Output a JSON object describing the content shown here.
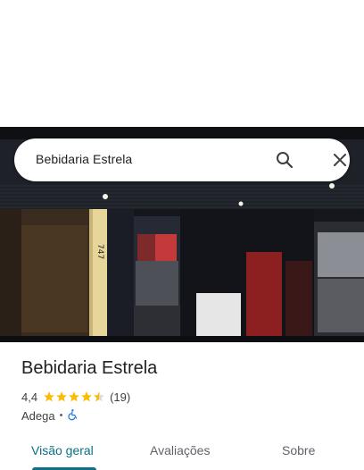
{
  "search": {
    "query": "Bebidaria Estrela",
    "search_icon": "search-icon",
    "close_icon": "close-icon"
  },
  "place": {
    "name": "Bebidaria Estrela",
    "rating": "4,4",
    "stars": 4.4,
    "review_count": "(19)",
    "category": "Adega",
    "separator": "•",
    "accessibility_icon": "wheelchair-icon"
  },
  "tabs": [
    {
      "label": "Visão geral",
      "active": true
    },
    {
      "label": "Avaliações",
      "active": false
    },
    {
      "label": "Sobre",
      "active": false
    }
  ],
  "colors": {
    "accent": "#0b6f86",
    "star": "#fbbc04",
    "accessibility": "#1a73e8"
  }
}
